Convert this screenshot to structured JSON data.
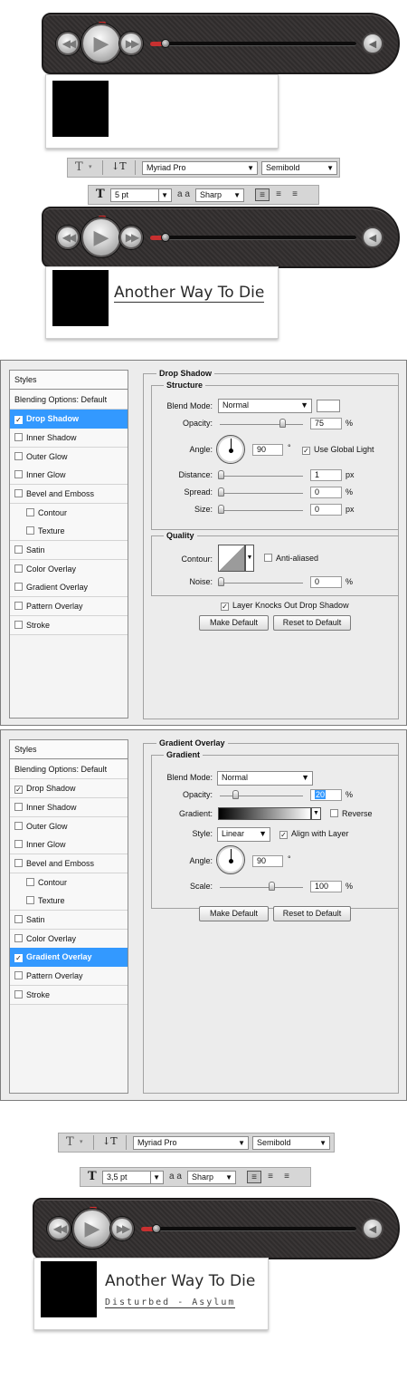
{
  "player": {
    "prev_icon": "rewind-icon",
    "play_icon": "play-icon",
    "next_icon": "fast-forward-icon",
    "volume_icon": "speaker-icon",
    "colors": {
      "progress": "#c73030",
      "body": "#332f2f"
    }
  },
  "song": {
    "title": "Another Way To Die",
    "artist_line": "Disturbed - Asylum"
  },
  "type_bar": {
    "tool_glyph": "T",
    "orient_glyph": "↓T",
    "font_family": "Myriad Pro",
    "font_style": "Semibold",
    "size_icon_glyph": "T",
    "aa_glyph": "a a",
    "anti_alias": "Sharp",
    "size_step2": "5 pt",
    "size_step3": "3,5 pt"
  },
  "drop_shadow_dialog": {
    "styles_header": "Styles",
    "blending": "Blending Options: Default",
    "items": [
      "Drop Shadow",
      "Inner Shadow",
      "Outer Glow",
      "Inner Glow",
      "Bevel and Emboss",
      "Contour",
      "Texture",
      "Satin",
      "Color Overlay",
      "Gradient Overlay",
      "Pattern Overlay",
      "Stroke"
    ],
    "section_title": "Drop Shadow",
    "structure_title": "Structure",
    "blend_mode_label": "Blend Mode:",
    "blend_mode": "Normal",
    "opacity_label": "Opacity:",
    "opacity": "75",
    "pct": "%",
    "angle_label": "Angle:",
    "angle": "90",
    "deg": "°",
    "global_light": "Use Global Light",
    "distance_label": "Distance:",
    "distance": "1",
    "px": "px",
    "spread_label": "Spread:",
    "spread": "0",
    "size_label": "Size:",
    "size": "0",
    "quality_title": "Quality",
    "contour_label": "Contour:",
    "anti_aliased": "Anti-aliased",
    "noise_label": "Noise:",
    "noise": "0",
    "knockout": "Layer Knocks Out Drop Shadow",
    "make_default": "Make Default",
    "reset_default": "Reset to Default"
  },
  "gradient_dialog": {
    "section_title": "Gradient Overlay",
    "gradient_title": "Gradient",
    "blend_mode_label": "Blend Mode:",
    "blend_mode": "Normal",
    "opacity_label": "Opacity:",
    "opacity": "20",
    "pct": "%",
    "gradient_label": "Gradient:",
    "reverse": "Reverse",
    "style_label": "Style:",
    "style": "Linear",
    "align_layer": "Align with Layer",
    "angle_label": "Angle:",
    "angle": "90",
    "deg": "°",
    "scale_label": "Scale:",
    "scale": "100",
    "make_default": "Make Default",
    "reset_default": "Reset to Default"
  }
}
